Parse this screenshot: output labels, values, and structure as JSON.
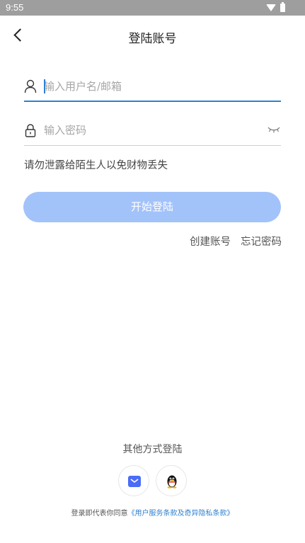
{
  "status_bar": {
    "time": "9:55"
  },
  "header": {
    "title": "登陆账号"
  },
  "form": {
    "username_placeholder": "输入用户名/邮箱",
    "password_placeholder": "输入密码",
    "warning": "请勿泄露给陌生人以免财物丢失",
    "login_label": "开始登陆",
    "create_account": "创建账号",
    "forgot_password": "忘记密码"
  },
  "footer": {
    "other_methods": "其他方式登陆",
    "agreement_prefix": "登录即代表你同意",
    "agreement_link": "《用户服务条款及奇异隐私条款》"
  },
  "colors": {
    "accent": "#2f80d1",
    "button": "#a2c2fa",
    "mail_icon": "#4a6cf7"
  },
  "icons": {
    "mail": "mail-icon",
    "qq": "qq-penguin-icon"
  }
}
